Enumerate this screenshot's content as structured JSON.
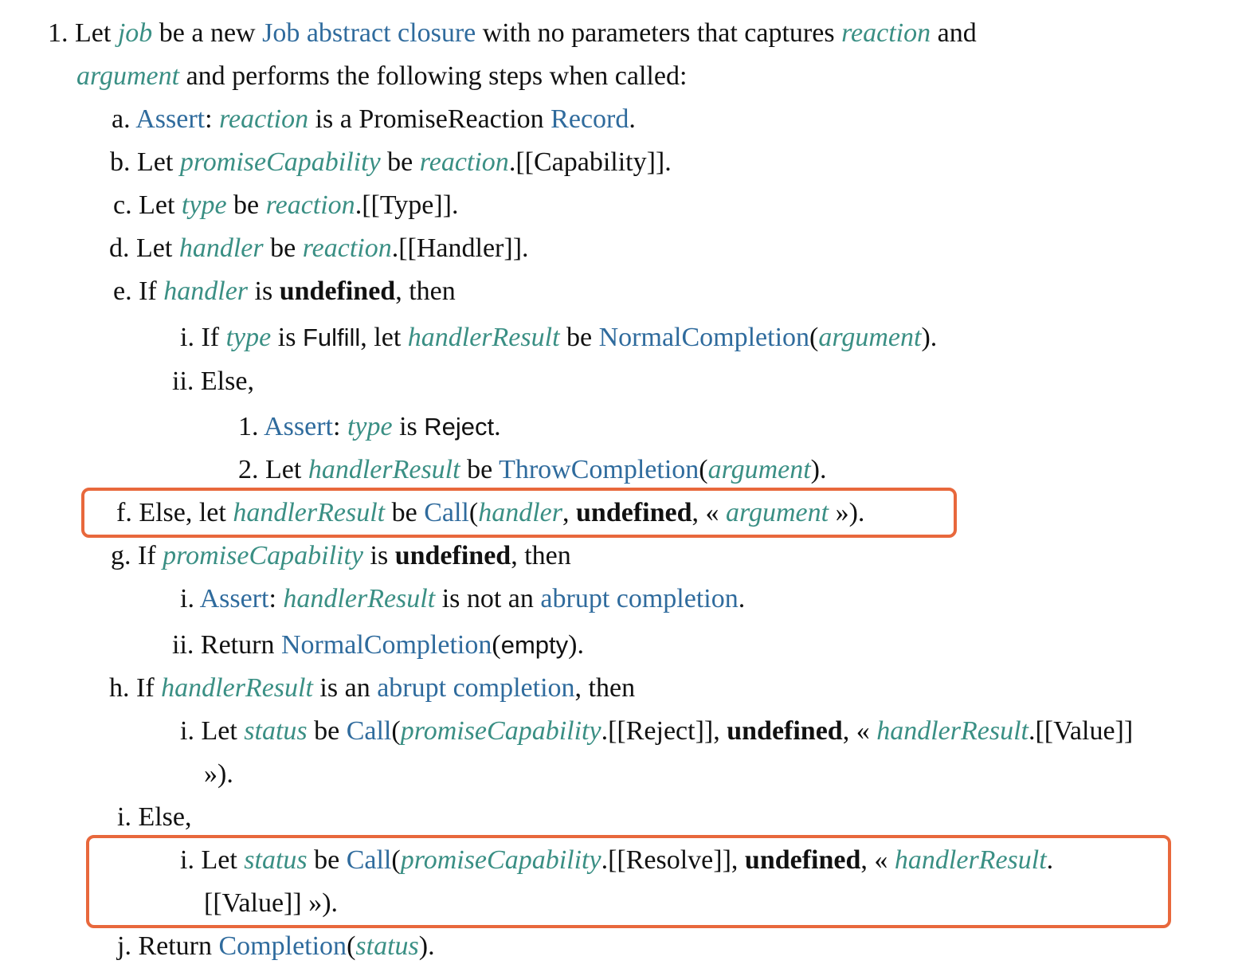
{
  "steps": [
    {
      "marker": "1.",
      "parts": [
        {
          "t": "Let ",
          "c": "txt"
        },
        {
          "t": "job",
          "c": "var"
        },
        {
          "t": " be a new ",
          "c": "txt"
        },
        {
          "t": "Job abstract closure",
          "c": "lnk"
        },
        {
          "t": " with no parameters that captures ",
          "c": "txt"
        },
        {
          "t": "reaction",
          "c": "var"
        },
        {
          "t": " and",
          "c": "txt"
        }
      ]
    },
    {
      "marker": "",
      "parts": [
        {
          "t": "argument",
          "c": "var"
        },
        {
          "t": " and performs the following steps when called:",
          "c": "txt"
        }
      ]
    },
    {
      "marker": "a.",
      "parts": [
        {
          "t": "Assert",
          "c": "lnk"
        },
        {
          "t": ": ",
          "c": "txt"
        },
        {
          "t": "reaction",
          "c": "var"
        },
        {
          "t": " is a PromiseReaction ",
          "c": "txt"
        },
        {
          "t": "Record",
          "c": "lnk"
        },
        {
          "t": ".",
          "c": "txt"
        }
      ]
    },
    {
      "marker": "b.",
      "parts": [
        {
          "t": "Let ",
          "c": "txt"
        },
        {
          "t": "promiseCapability",
          "c": "var"
        },
        {
          "t": " be ",
          "c": "txt"
        },
        {
          "t": "reaction",
          "c": "var"
        },
        {
          "t": ".[[Capability]].",
          "c": "txt"
        }
      ]
    },
    {
      "marker": "c.",
      "parts": [
        {
          "t": "Let ",
          "c": "txt"
        },
        {
          "t": "type",
          "c": "var"
        },
        {
          "t": " be ",
          "c": "txt"
        },
        {
          "t": "reaction",
          "c": "var"
        },
        {
          "t": ".[[Type]].",
          "c": "txt"
        }
      ]
    },
    {
      "marker": "d.",
      "parts": [
        {
          "t": "Let ",
          "c": "txt"
        },
        {
          "t": "handler",
          "c": "var"
        },
        {
          "t": " be ",
          "c": "txt"
        },
        {
          "t": "reaction",
          "c": "var"
        },
        {
          "t": ".[[Handler]].",
          "c": "txt"
        }
      ]
    },
    {
      "marker": "e.",
      "parts": [
        {
          "t": "If ",
          "c": "txt"
        },
        {
          "t": "handler",
          "c": "var"
        },
        {
          "t": " is ",
          "c": "txt"
        },
        {
          "t": "undefined",
          "c": "kw"
        },
        {
          "t": ", then",
          "c": "txt"
        }
      ]
    },
    {
      "marker": "i.",
      "parts": [
        {
          "t": "If ",
          "c": "txt"
        },
        {
          "t": "type",
          "c": "var"
        },
        {
          "t": " is ",
          "c": "txt"
        },
        {
          "t": "Fulfill",
          "c": "sans"
        },
        {
          "t": ", let ",
          "c": "txt"
        },
        {
          "t": "handlerResult",
          "c": "var"
        },
        {
          "t": " be ",
          "c": "txt"
        },
        {
          "t": "NormalCompletion",
          "c": "lnk"
        },
        {
          "t": "(",
          "c": "txt"
        },
        {
          "t": "argument",
          "c": "var"
        },
        {
          "t": ").",
          "c": "txt"
        }
      ]
    },
    {
      "marker": "ii.",
      "parts": [
        {
          "t": "Else,",
          "c": "txt"
        }
      ]
    },
    {
      "marker": "1.",
      "parts": [
        {
          "t": "Assert",
          "c": "lnk"
        },
        {
          "t": ": ",
          "c": "txt"
        },
        {
          "t": "type",
          "c": "var"
        },
        {
          "t": " is ",
          "c": "txt"
        },
        {
          "t": "Reject",
          "c": "sans"
        },
        {
          "t": ".",
          "c": "txt"
        }
      ]
    },
    {
      "marker": "2.",
      "parts": [
        {
          "t": "Let ",
          "c": "txt"
        },
        {
          "t": "handlerResult",
          "c": "var"
        },
        {
          "t": " be ",
          "c": "txt"
        },
        {
          "t": "ThrowCompletion",
          "c": "lnk"
        },
        {
          "t": "(",
          "c": "txt"
        },
        {
          "t": "argument",
          "c": "var"
        },
        {
          "t": ").",
          "c": "txt"
        }
      ]
    },
    {
      "marker": "f.",
      "parts": [
        {
          "t": "Else, let ",
          "c": "txt"
        },
        {
          "t": "handlerResult",
          "c": "var"
        },
        {
          "t": " be ",
          "c": "txt"
        },
        {
          "t": "Call",
          "c": "lnk"
        },
        {
          "t": "(",
          "c": "txt"
        },
        {
          "t": "handler",
          "c": "var"
        },
        {
          "t": ", ",
          "c": "txt"
        },
        {
          "t": "undefined",
          "c": "kw"
        },
        {
          "t": ", « ",
          "c": "txt"
        },
        {
          "t": "argument",
          "c": "var"
        },
        {
          "t": " »).",
          "c": "txt"
        }
      ]
    },
    {
      "marker": "g.",
      "parts": [
        {
          "t": "If ",
          "c": "txt"
        },
        {
          "t": "promiseCapability",
          "c": "var"
        },
        {
          "t": " is ",
          "c": "txt"
        },
        {
          "t": "undefined",
          "c": "kw"
        },
        {
          "t": ", then",
          "c": "txt"
        }
      ]
    },
    {
      "marker": "i.",
      "parts": [
        {
          "t": "Assert",
          "c": "lnk"
        },
        {
          "t": ": ",
          "c": "txt"
        },
        {
          "t": "handlerResult",
          "c": "var"
        },
        {
          "t": " is not an ",
          "c": "txt"
        },
        {
          "t": "abrupt completion",
          "c": "lnk"
        },
        {
          "t": ".",
          "c": "txt"
        }
      ]
    },
    {
      "marker": "ii.",
      "parts": [
        {
          "t": "Return ",
          "c": "txt"
        },
        {
          "t": "NormalCompletion",
          "c": "lnk"
        },
        {
          "t": "(",
          "c": "txt"
        },
        {
          "t": "empty",
          "c": "sans"
        },
        {
          "t": ").",
          "c": "txt"
        }
      ]
    },
    {
      "marker": "h.",
      "parts": [
        {
          "t": "If ",
          "c": "txt"
        },
        {
          "t": "handlerResult",
          "c": "var"
        },
        {
          "t": " is an ",
          "c": "txt"
        },
        {
          "t": "abrupt completion",
          "c": "lnk"
        },
        {
          "t": ", then",
          "c": "txt"
        }
      ]
    },
    {
      "marker": "i.",
      "parts": [
        {
          "t": "Let ",
          "c": "txt"
        },
        {
          "t": "status",
          "c": "var"
        },
        {
          "t": " be ",
          "c": "txt"
        },
        {
          "t": "Call",
          "c": "lnk"
        },
        {
          "t": "(",
          "c": "txt"
        },
        {
          "t": "promiseCapability",
          "c": "var"
        },
        {
          "t": ".[[Reject]], ",
          "c": "txt"
        },
        {
          "t": "undefined",
          "c": "kw"
        },
        {
          "t": ", « ",
          "c": "txt"
        },
        {
          "t": "handlerResult",
          "c": "var"
        },
        {
          "t": ".[[Value]]",
          "c": "txt"
        }
      ]
    },
    {
      "marker": "",
      "parts": [
        {
          "t": "»).",
          "c": "txt"
        }
      ]
    },
    {
      "marker": "i.",
      "parts": [
        {
          "t": "Else,",
          "c": "txt"
        }
      ]
    },
    {
      "marker": "i.",
      "parts": [
        {
          "t": "Let ",
          "c": "txt"
        },
        {
          "t": "status",
          "c": "var"
        },
        {
          "t": " be ",
          "c": "txt"
        },
        {
          "t": "Call",
          "c": "lnk"
        },
        {
          "t": "(",
          "c": "txt"
        },
        {
          "t": "promiseCapability",
          "c": "var"
        },
        {
          "t": ".[[Resolve]], ",
          "c": "txt"
        },
        {
          "t": "undefined",
          "c": "kw"
        },
        {
          "t": ", « ",
          "c": "txt"
        },
        {
          "t": "handlerResult",
          "c": "var"
        },
        {
          "t": ".",
          "c": "txt"
        }
      ]
    },
    {
      "marker": "",
      "parts": [
        {
          "t": "[[Value]] »).",
          "c": "txt"
        }
      ]
    },
    {
      "marker": "j.",
      "parts": [
        {
          "t": "Return ",
          "c": "txt"
        },
        {
          "t": "Completion",
          "c": "lnk"
        },
        {
          "t": "(",
          "c": "txt"
        },
        {
          "t": "status",
          "c": "var"
        },
        {
          "t": ").",
          "c": "txt"
        }
      ]
    }
  ],
  "colors": {
    "variable": "#3a8f84",
    "link": "#2f6b9d",
    "highlight": "#e8683c"
  }
}
